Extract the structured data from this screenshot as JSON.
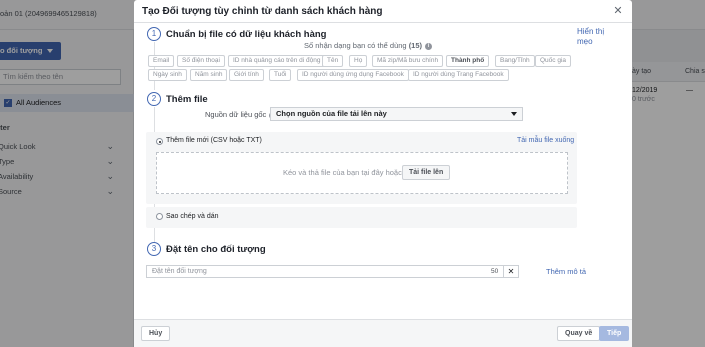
{
  "background": {
    "account_label": "oản 01 (2049699465129818)",
    "create_button_label": "o đối tượng",
    "search_placeholder": "Tìm kiếm theo tên",
    "all_audiences": "All Audiences",
    "filter_heading": "ilter",
    "filters": [
      "Quick Look",
      "Type",
      "Availability",
      "Source"
    ],
    "table_headers": [
      "ày tạo",
      "Chia s"
    ],
    "table_row": [
      "12/2019",
      "—"
    ],
    "table_row_sub": "0 trước"
  },
  "modal": {
    "title": "Tạo Đối tượng tùy chỉnh từ danh sách khách hàng",
    "close_icon": "close-icon",
    "step1": {
      "number": "1",
      "title": "Chuẩn bị file có dữ liệu khách hàng",
      "hint_label": "Hiển thị mẹo",
      "id_count_text": "Số nhận dạng bạn có thể dùng",
      "id_count_number": "(15)",
      "identifiers": [
        {
          "label": "Email",
          "active": false
        },
        {
          "label": "Số điện thoại",
          "active": false
        },
        {
          "label": "ID nhà quảng cáo trên di động",
          "active": false
        },
        {
          "label": "Tên",
          "active": false
        },
        {
          "label": "Họ",
          "active": false
        },
        {
          "label": "Mã zip/Mã bưu chính",
          "active": false
        },
        {
          "label": "Thành phố",
          "active": true
        },
        {
          "label": "Bang/Tỉnh",
          "active": false
        },
        {
          "label": "Quốc gia",
          "active": false
        },
        {
          "label": "Ngày sinh",
          "active": false
        },
        {
          "label": "Năm sinh",
          "active": false
        },
        {
          "label": "Giới tính",
          "active": false
        },
        {
          "label": "Tuổi",
          "active": false
        },
        {
          "label": "ID người dùng ứng dụng Facebook",
          "active": false
        },
        {
          "label": "ID người dùng Trang Facebook",
          "active": false
        }
      ]
    },
    "step2": {
      "number": "2",
      "title": "Thêm file",
      "source_label": "Nguồn dữ liệu gốc",
      "source_value": "Chọn nguồn của file tải lên này",
      "new_file_label": "Thêm file mới (CSV hoặc TXT)",
      "template_link": "Tải mẫu file xuống",
      "drop_text": "Kéo và thả file của bạn tại đây hoặc",
      "upload_button": "Tải file lên",
      "paste_label": "Sao chép và dán"
    },
    "step3": {
      "number": "3",
      "title": "Đặt tên cho đối tượng",
      "name_placeholder": "Đặt tên đối tượng",
      "char_count": "50",
      "clear_label": "✕",
      "description_link": "Thêm mô tả"
    },
    "footer": {
      "cancel_label": "Hủy",
      "back_label": "Quay về",
      "next_label": "Tiếp"
    }
  }
}
